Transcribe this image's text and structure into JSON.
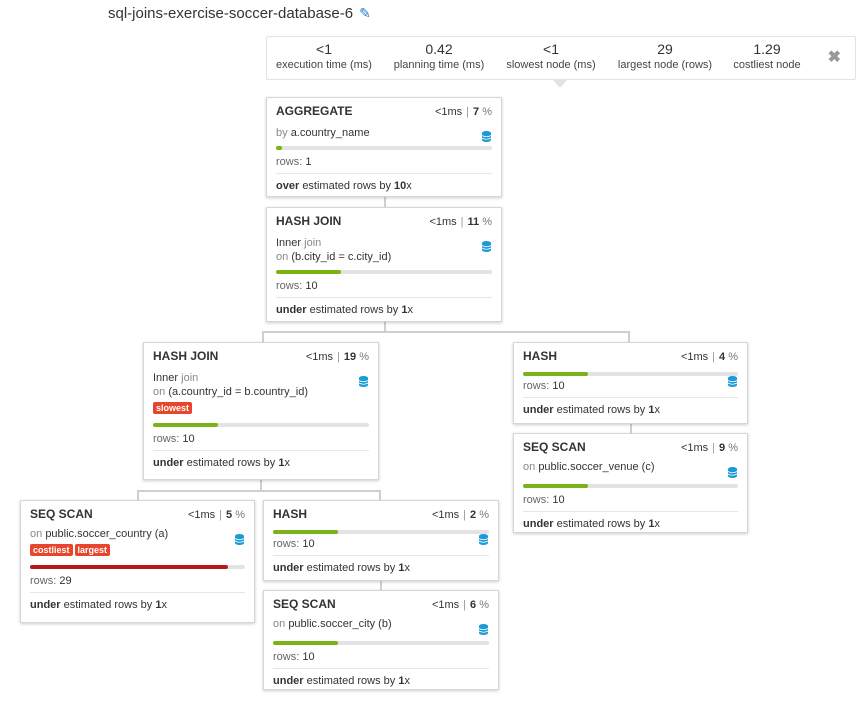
{
  "title": "sql-joins-exercise-soccer-database-6",
  "icons": {
    "edit": "pencil-icon",
    "close": "close-icon",
    "db": "database-icon"
  },
  "stats": [
    {
      "value": "<1",
      "label": "execution time (ms)"
    },
    {
      "value": "0.42",
      "label": "planning time (ms)"
    },
    {
      "value": "<1",
      "label": "slowest node (ms)"
    },
    {
      "value": "29",
      "label": "largest node (rows)"
    },
    {
      "value": "1.29",
      "label": "costliest node"
    }
  ],
  "close_label": "✖",
  "nodes": {
    "aggregate": {
      "name": "AGGREGATE",
      "time": "<1ms",
      "pct": "7",
      "pct_sign": "%",
      "desc_prefix": "by",
      "desc_value": "a.country_name",
      "rows_label": "rows:",
      "rows": "1",
      "est_dir": "over",
      "est_text": "estimated rows by",
      "est_factor": "10",
      "est_x": "x",
      "bar_fraction": 0.03
    },
    "hash_join_1": {
      "name": "HASH JOIN",
      "time": "<1ms",
      "pct": "11",
      "pct_sign": "%",
      "join_type": "Inner",
      "join_word": "join",
      "on_word": "on",
      "cond": "(b.city_id = c.city_id)",
      "rows_label": "rows:",
      "rows": "10",
      "est_dir": "under",
      "est_text": "estimated rows by",
      "est_factor": "1",
      "est_x": "x",
      "bar_fraction": 0.3
    },
    "hash_join_2": {
      "name": "HASH JOIN",
      "time": "<1ms",
      "pct": "19",
      "pct_sign": "%",
      "join_type": "Inner",
      "join_word": "join",
      "on_word": "on",
      "cond": "(a.country_id = b.country_id)",
      "tag": "slowest",
      "rows_label": "rows:",
      "rows": "10",
      "est_dir": "under",
      "est_text": "estimated rows by",
      "est_factor": "1",
      "est_x": "x",
      "bar_fraction": 0.3
    },
    "hash_right": {
      "name": "HASH",
      "time": "<1ms",
      "pct": "4",
      "pct_sign": "%",
      "rows_label": "rows:",
      "rows": "10",
      "est_dir": "under",
      "est_text": "estimated rows by",
      "est_factor": "1",
      "est_x": "x",
      "bar_fraction": 0.3
    },
    "seq_venue": {
      "name": "SEQ SCAN",
      "time": "<1ms",
      "pct": "9",
      "pct_sign": "%",
      "on_word": "on",
      "table": "public.soccer_venue (c)",
      "rows_label": "rows:",
      "rows": "10",
      "est_dir": "under",
      "est_text": "estimated rows by",
      "est_factor": "1",
      "est_x": "x",
      "bar_fraction": 0.3
    },
    "seq_country": {
      "name": "SEQ SCAN",
      "time": "<1ms",
      "pct": "5",
      "pct_sign": "%",
      "on_word": "on",
      "table": "public.soccer_country (a)",
      "tags": [
        "costliest",
        "largest"
      ],
      "rows_label": "rows:",
      "rows": "29",
      "est_dir": "under",
      "est_text": "estimated rows by",
      "est_factor": "1",
      "est_x": "x",
      "bar_fraction": 0.92,
      "bar_color": "#b31b1b"
    },
    "hash_mid": {
      "name": "HASH",
      "time": "<1ms",
      "pct": "2",
      "pct_sign": "%",
      "rows_label": "rows:",
      "rows": "10",
      "est_dir": "under",
      "est_text": "estimated rows by",
      "est_factor": "1",
      "est_x": "x",
      "bar_fraction": 0.3
    },
    "seq_city": {
      "name": "SEQ SCAN",
      "time": "<1ms",
      "pct": "6",
      "pct_sign": "%",
      "on_word": "on",
      "table": "public.soccer_city (b)",
      "rows_label": "rows:",
      "rows": "10",
      "est_dir": "under",
      "est_text": "estimated rows by",
      "est_factor": "1",
      "est_x": "x",
      "bar_fraction": 0.3
    }
  },
  "colors": {
    "bar_green": "#7ab317",
    "bar_red": "#b31b1b",
    "tag": "#e7452c",
    "db_icon": "#1a9bd7"
  }
}
